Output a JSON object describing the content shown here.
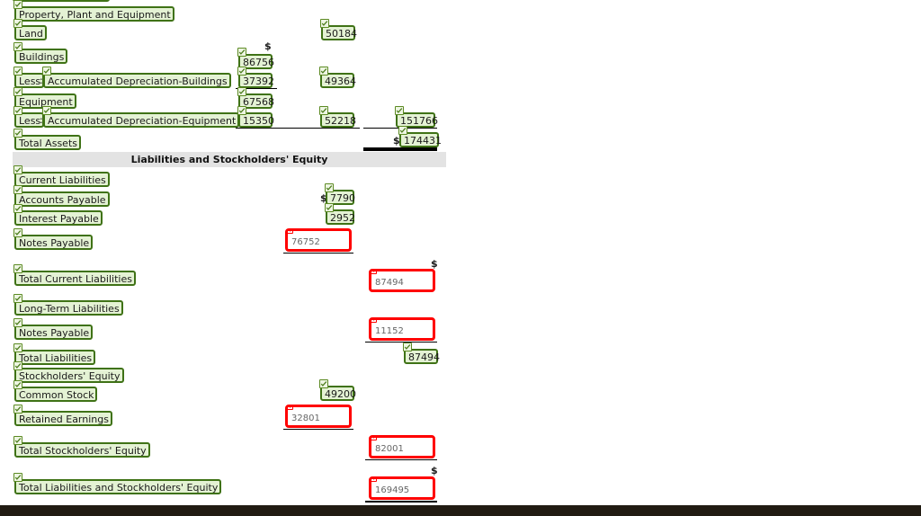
{
  "document": {
    "type": "balance-sheet-worksheet",
    "section_header": "Liabilities and Stockholders' Equity"
  },
  "colors": {
    "correct_border": "#3f7216",
    "correct_fill": "#e4f2d4",
    "incorrect_border": "#ff0000",
    "band_gray": "#e3e3e3",
    "bottom_bar": "#211b12"
  },
  "symbols": {
    "dollar": "$",
    "colon": ":",
    "check_icon": "check-icon",
    "x_icon": "x-icon"
  },
  "assets": {
    "rows": [
      {
        "label": "Property, Plant and Equipment",
        "status": "correct"
      },
      {
        "label": "Land",
        "status": "correct",
        "col2": "50184"
      },
      {
        "label": "Buildings",
        "status": "correct",
        "col1": "86756",
        "col1_dollar": "$"
      },
      {
        "label_prefix": "Less",
        "label": "Accumulated Depreciation-Buildings",
        "status": "correct",
        "col1": "37392",
        "col2": "49364"
      },
      {
        "label": "Equipment",
        "status": "correct",
        "col1": "67568"
      },
      {
        "label_prefix": "Less",
        "label": "Accumulated Depreciation-Equipment",
        "status": "correct",
        "col1": "15350",
        "col2": "52218",
        "col3": "151766"
      },
      {
        "label": "Total Assets",
        "status": "correct",
        "col3": "174431",
        "col3_dollar": "$"
      }
    ]
  },
  "liabilities": {
    "rows": [
      {
        "label": "Current Liabilities",
        "status": "correct"
      },
      {
        "label": "Accounts Payable",
        "status": "correct",
        "col2": "7790",
        "col2_dollar": "$"
      },
      {
        "label": "Interest Payable",
        "status": "correct",
        "col2": "2952"
      },
      {
        "label": "Notes Payable",
        "status": "correct",
        "col2_input": "76752",
        "input_status": "incorrect"
      },
      {
        "label": "Total Current Liabilities",
        "status": "correct",
        "col3_input": "87494",
        "input_status": "incorrect",
        "col3_dollar": "$"
      },
      {
        "label": "Long-Term Liabilities",
        "status": "correct"
      },
      {
        "label": "Notes Payable",
        "status": "correct",
        "col3_input": "11152",
        "input_status": "incorrect"
      },
      {
        "label": "Total Liabilities",
        "status": "correct",
        "col3": "87494"
      }
    ]
  },
  "equity": {
    "rows": [
      {
        "label": "Stockholders' Equity",
        "status": "correct"
      },
      {
        "label": "Common Stock",
        "status": "correct",
        "col2": "49200"
      },
      {
        "label": "Retained Earnings",
        "status": "correct",
        "col2_input": "32801",
        "input_status": "incorrect"
      },
      {
        "label": "Total Stockholders' Equity",
        "status": "correct",
        "col3_input": "82001",
        "input_status": "incorrect"
      },
      {
        "label": "Total Liabilities and Stockholders' Equity",
        "status": "correct",
        "col3_input": "169495",
        "input_status": "incorrect",
        "col3_dollar": "$"
      }
    ]
  }
}
